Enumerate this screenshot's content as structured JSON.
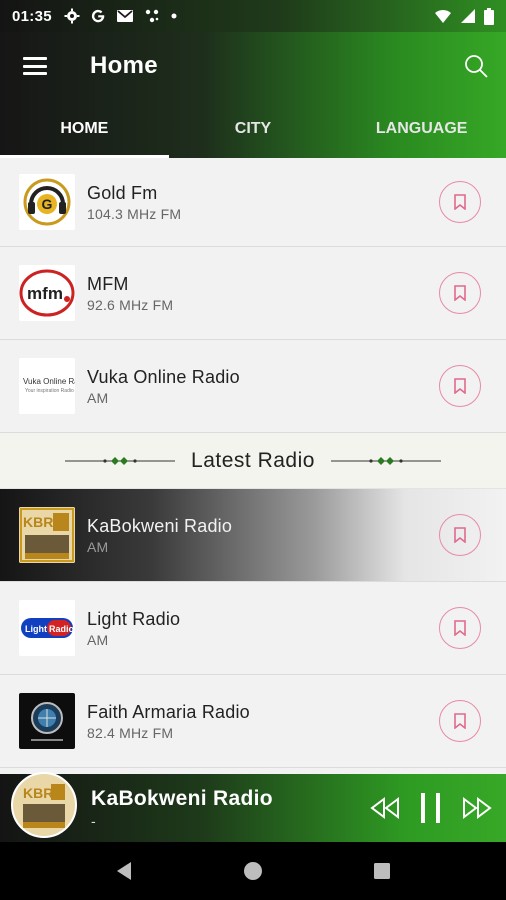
{
  "status_bar": {
    "time": "01:35",
    "icons": [
      "gear-icon",
      "google-icon",
      "gmail-icon",
      "app-icon",
      "dot-icon"
    ],
    "right_icons": [
      "wifi-icon",
      "signal-icon",
      "battery-icon"
    ]
  },
  "app_bar": {
    "title": "Home",
    "menu_icon": "hamburger-menu-icon",
    "search_icon": "search-icon"
  },
  "tabs": [
    {
      "label": "HOME",
      "active": true
    },
    {
      "label": "CITY",
      "active": false
    },
    {
      "label": "LANGUAGE",
      "active": false
    }
  ],
  "stations": [
    {
      "name": "Gold Fm",
      "freq": "104.3 MHz FM",
      "logo": "gold-fm-logo"
    },
    {
      "name": "MFM",
      "freq": "92.6 MHz FM",
      "logo": "mfm-logo"
    },
    {
      "name": "Vuka Online Radio",
      "freq": "AM",
      "logo": "vuka-logo"
    }
  ],
  "section": {
    "title": "Latest Radio"
  },
  "latest": [
    {
      "name": "KaBokweni Radio",
      "freq": "AM",
      "logo": "kbr-logo"
    },
    {
      "name": "Light Radio",
      "freq": "AM",
      "logo": "light-radio-logo"
    },
    {
      "name": "Faith Armaria Radio",
      "freq": "82.4 MHz FM",
      "logo": "faith-logo"
    }
  ],
  "player": {
    "name": "KaBokweni Radio",
    "sub": "-"
  },
  "logo_text": {
    "gold": "G",
    "mfm": "mfm",
    "vuka_line1": "Vuka Online Radio",
    "vuka_line2": "Your inspiration Radio",
    "kbr": "KBR",
    "light_a": "Light",
    "light_b": "Radio"
  },
  "colors": {
    "accent_green": "#2f9a22",
    "bookmark_pink": "#e88aa6",
    "dark": "#141414"
  }
}
